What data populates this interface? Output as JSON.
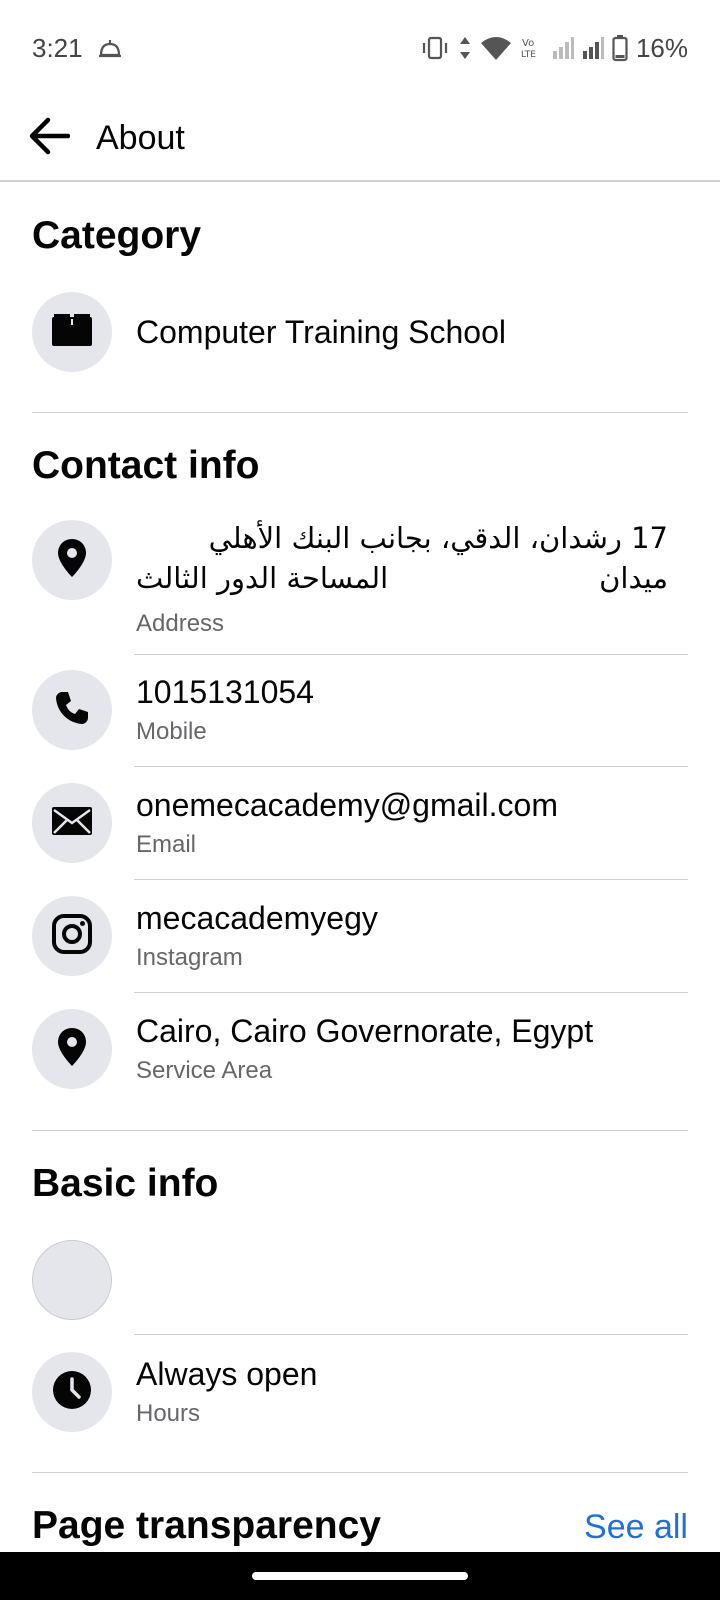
{
  "status_bar": {
    "time": "3:21",
    "battery": "16%",
    "icons": [
      "alarm-icon",
      "vibrate-icon",
      "data-arrows-icon",
      "wifi-icon",
      "volte-icon",
      "signal-icon",
      "signal-icon",
      "battery-icon"
    ]
  },
  "header": {
    "title": "About",
    "back_icon": "back-arrow-icon"
  },
  "category": {
    "title": "Category",
    "value": "Computer Training School",
    "icon": "book-icon"
  },
  "contact_info": {
    "title": "Contact info",
    "address": {
      "line1": "17 رشدان، الدقي، بجانب البنك الأهلي ميدان",
      "line2": "المساحة  الدور الثالث",
      "label": "Address",
      "icon": "location-pin-icon"
    },
    "mobile": {
      "value": "1015131054",
      "label": "Mobile",
      "icon": "phone-icon"
    },
    "email": {
      "value": "onemecacademy@gmail.com",
      "label": "Email",
      "icon": "mail-icon"
    },
    "instagram": {
      "value": "mecacademyegy",
      "label": "Instagram",
      "icon": "instagram-icon"
    },
    "service_area": {
      "value": "Cairo, Cairo Governorate, Egypt",
      "label": "Service Area",
      "icon": "location-pin-icon"
    }
  },
  "basic_info": {
    "title": "Basic info",
    "hours": {
      "value": "Always open",
      "label": "Hours",
      "icon": "clock-icon"
    }
  },
  "page_transparency": {
    "title": "Page transparency",
    "see_all": "See all"
  },
  "colors": {
    "link": "#216fdb",
    "icon_bg": "#e4e6eb",
    "secondary_text": "#65676b"
  }
}
